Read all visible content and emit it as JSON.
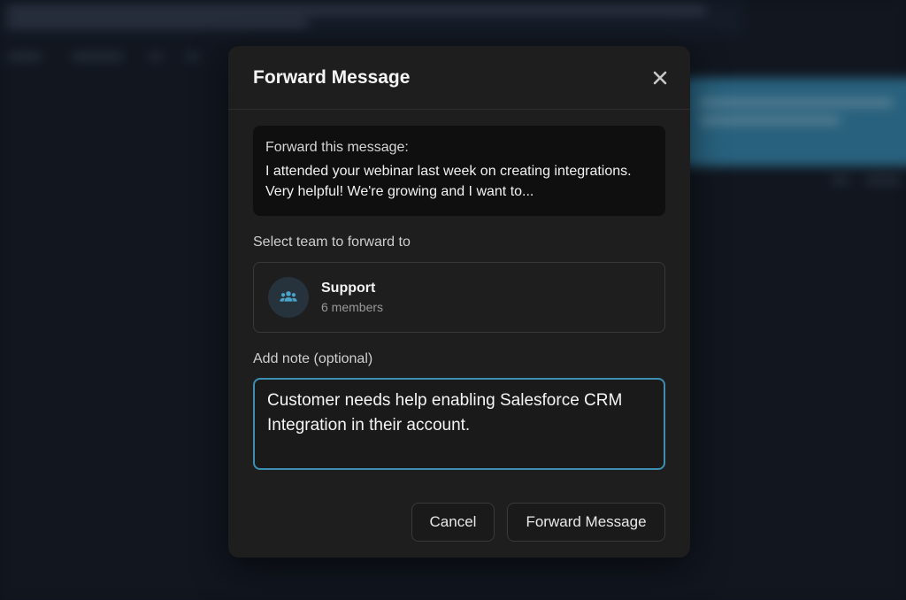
{
  "dialog": {
    "title": "Forward Message",
    "close_icon": "close-icon"
  },
  "preview": {
    "label": "Forward this message:",
    "text": "I attended your webinar last week on creating integrations. Very helpful! We're growing and I want to..."
  },
  "team_section": {
    "label": "Select team to forward to",
    "team": {
      "icon": "team-icon",
      "name": "Support",
      "members": "6 members"
    }
  },
  "note": {
    "label": "Add note (optional)",
    "value": "Customer needs help enabling Salesforce CRM Integration in their account."
  },
  "actions": {
    "cancel_label": "Cancel",
    "forward_label": "Forward Message"
  },
  "colors": {
    "accent": "#3c8fb3",
    "modal_bg": "#1e1e1f",
    "team_icon": "#4aa3c9"
  }
}
